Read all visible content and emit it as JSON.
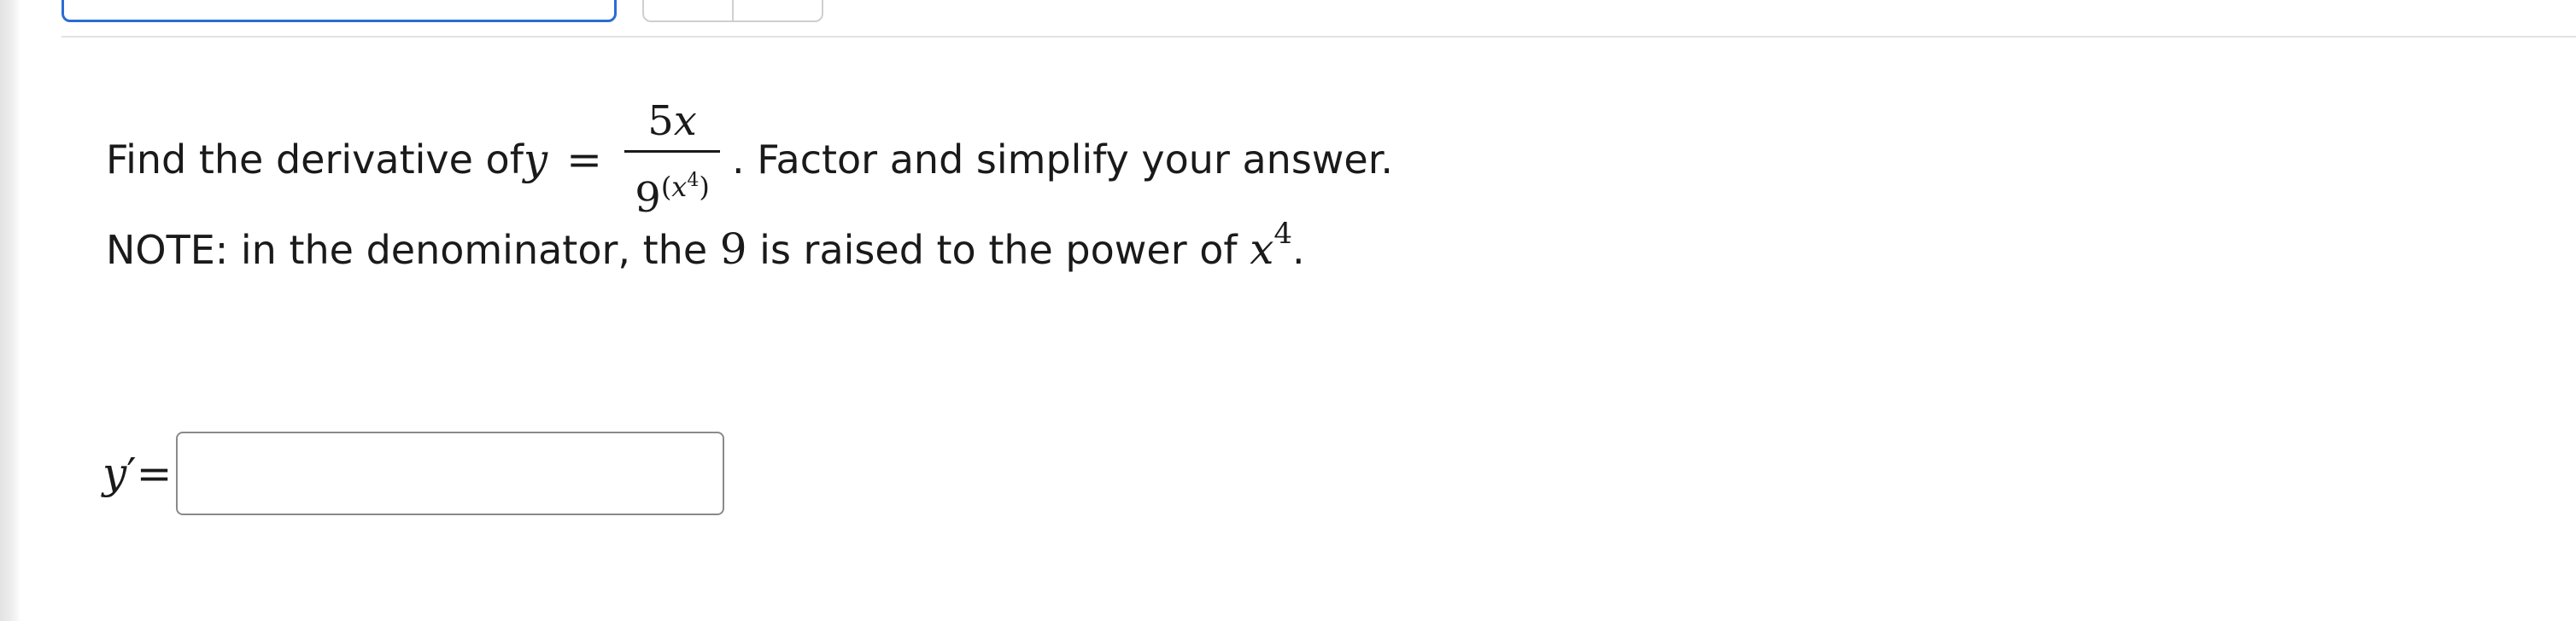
{
  "question": {
    "intro": "Find the derivative of ",
    "y_var": "y",
    "equals": "=",
    "numerator": "5x",
    "denominator_base": "9",
    "denominator_exp_open": "(",
    "denominator_exp_var": "x",
    "denominator_exp_power": "4",
    "denominator_exp_close": ")",
    "after": ". Factor and simplify your answer.",
    "note_prefix": "NOTE: in the denominator, the ",
    "note_base": "9",
    "note_middle": " is raised to the power of ",
    "note_var": "x",
    "note_power": "4",
    "note_end": "."
  },
  "answer": {
    "label_var": "y",
    "label_prime": "′",
    "label_equals": "=",
    "value": ""
  }
}
